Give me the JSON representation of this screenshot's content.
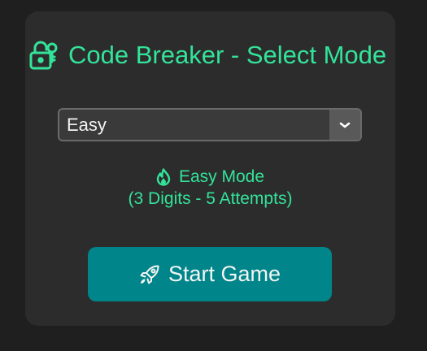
{
  "header": {
    "title": "Code Breaker - Select Mode",
    "icon": "padlock-key-icon"
  },
  "mode_select": {
    "selected": "Easy",
    "arrow_icon": "chevron-down-icon"
  },
  "mode_info": {
    "icon": "fire-icon",
    "name": "Easy Mode",
    "details": "(3 Digits - 5 Attempts)"
  },
  "start_button": {
    "label": "Start Game",
    "icon": "rocket-icon"
  },
  "colors": {
    "background": "#1f1f1f",
    "card": "#2c2c2c",
    "accent": "#33e39a",
    "button": "#00858a"
  }
}
